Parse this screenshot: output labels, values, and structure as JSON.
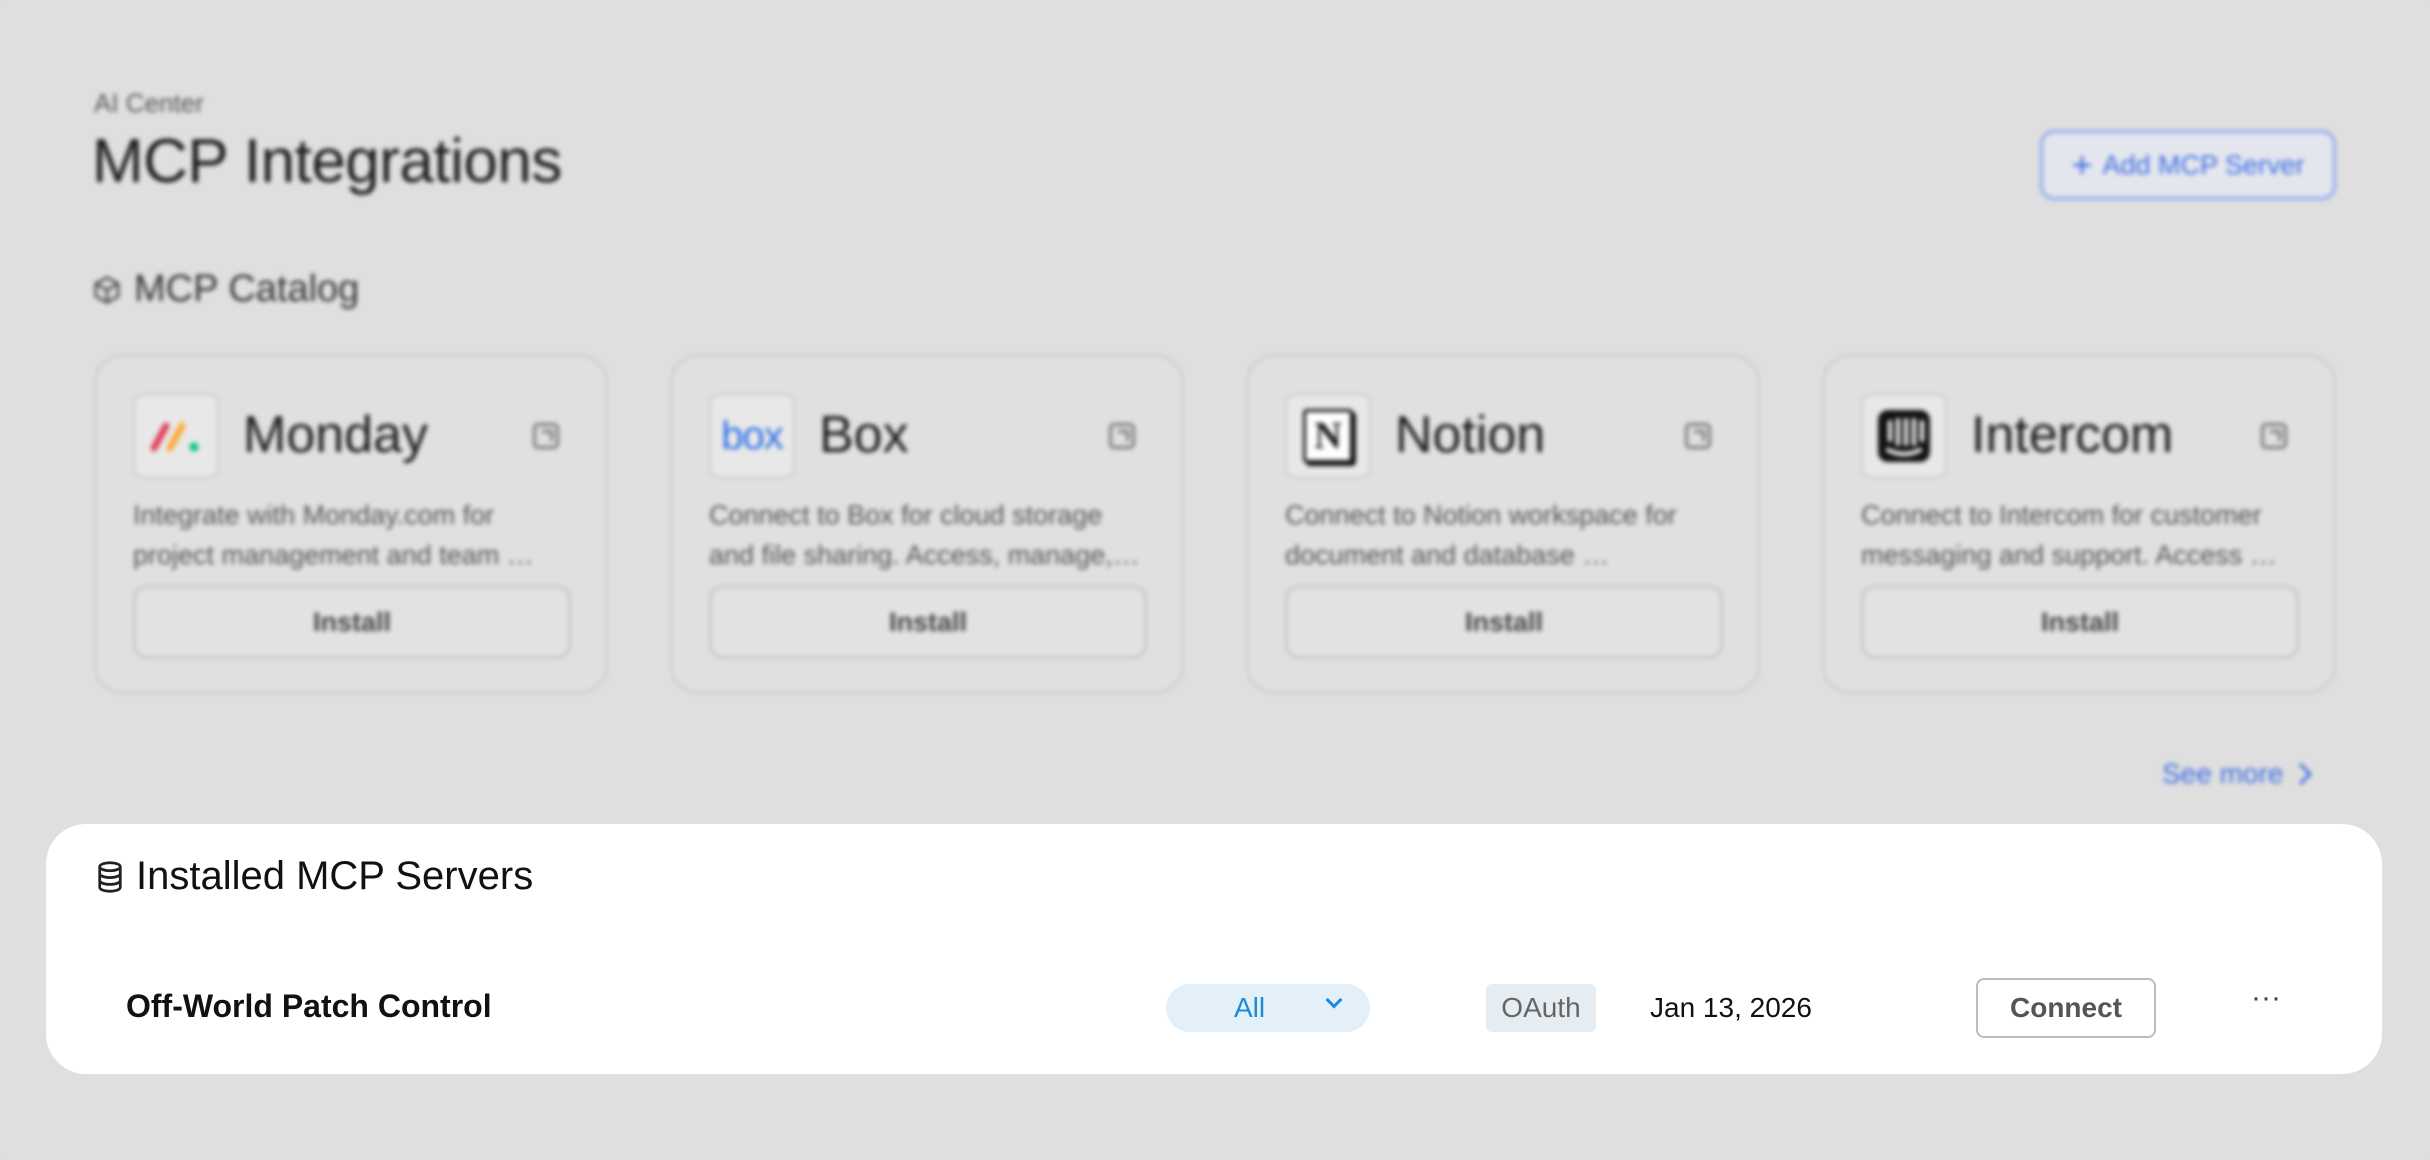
{
  "header": {
    "breadcrumb": "AI Center",
    "title": "MCP Integrations",
    "add_button_label": "Add MCP Server"
  },
  "catalog": {
    "heading": "MCP Catalog",
    "cards": [
      {
        "name": "Monday",
        "logo": "monday-logo",
        "desc_line1": "Integrate with Monday.com for",
        "desc_line2": "project management and team …",
        "install_label": "Install"
      },
      {
        "name": "Box",
        "logo": "box-logo",
        "logo_text": "box",
        "desc_line1": "Connect to Box for cloud storage",
        "desc_line2": "and file sharing. Access, manage,…",
        "install_label": "Install"
      },
      {
        "name": "Notion",
        "logo": "notion-logo",
        "logo_text": "N",
        "desc_line1": "Connect to Notion workspace for",
        "desc_line2": "document and database …",
        "install_label": "Install"
      },
      {
        "name": "Intercom",
        "logo": "intercom-logo",
        "desc_line1": "Connect to Intercom for customer",
        "desc_line2": "messaging and support. Access …",
        "install_label": "Install"
      }
    ],
    "see_more_label": "See more"
  },
  "installed": {
    "heading": "Installed MCP Servers",
    "rows": [
      {
        "name": "Off-World Patch Control",
        "scope": "All",
        "auth": "OAuth",
        "date": "Jan 13, 2026",
        "connect_label": "Connect",
        "more_label": "···"
      }
    ]
  },
  "colors": {
    "accent": "#3b6be0",
    "scope_text": "#1f8ad6",
    "scope_bg": "#e3f0fa",
    "backdrop": "#dedede"
  }
}
